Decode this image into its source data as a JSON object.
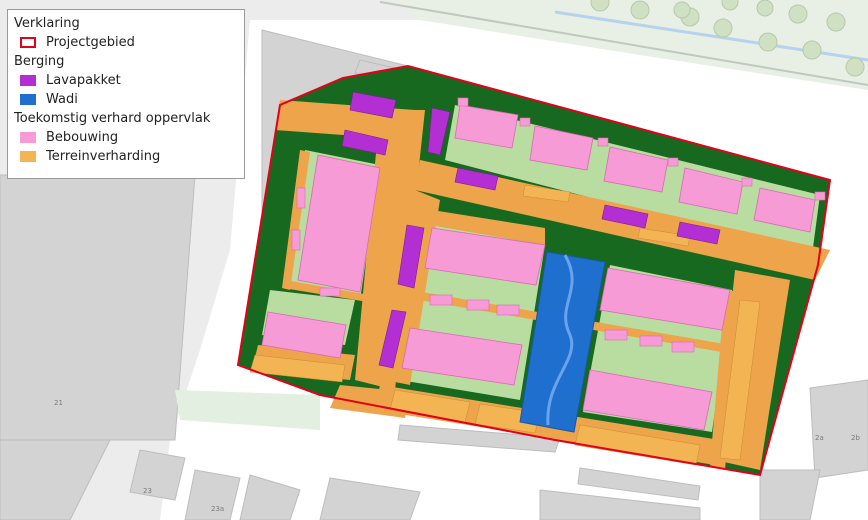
{
  "legend": {
    "title": "Verklaring",
    "items": [
      {
        "kind": "swatch",
        "label": "Projectgebied",
        "style": "outline",
        "color": "#e3001b"
      },
      {
        "kind": "header",
        "label": "Berging"
      },
      {
        "kind": "swatch",
        "label": "Lavapakket",
        "style": "fill",
        "color": "#b42fd3"
      },
      {
        "kind": "swatch",
        "label": "Wadi",
        "style": "fill",
        "color": "#1f6fcf"
      },
      {
        "kind": "header",
        "label": "Toekomstig verhard oppervlak"
      },
      {
        "kind": "swatch",
        "label": "Bebouwing",
        "style": "fill",
        "color": "#f79bd6"
      },
      {
        "kind": "swatch",
        "label": "Terreinverharding",
        "style": "fill",
        "color": "#f3b554"
      }
    ]
  },
  "map_labels": {
    "label_21": "21",
    "label_23": "23",
    "label_23a": "23a",
    "label_2a": "2a",
    "label_2b": "2b"
  },
  "colors": {
    "background": "#ececec",
    "white_zone": "#ffffff",
    "building_grey": "#d3d3d3",
    "green_dark": "#17691f",
    "green_light": "#b9dca1",
    "paving": "#eda44b",
    "paving_light": "#f3b554",
    "bebouwing": "#f79bd6",
    "lavapakket": "#b42fd3",
    "wadi": "#1f6fcf",
    "project_outline": "#e3001b"
  }
}
